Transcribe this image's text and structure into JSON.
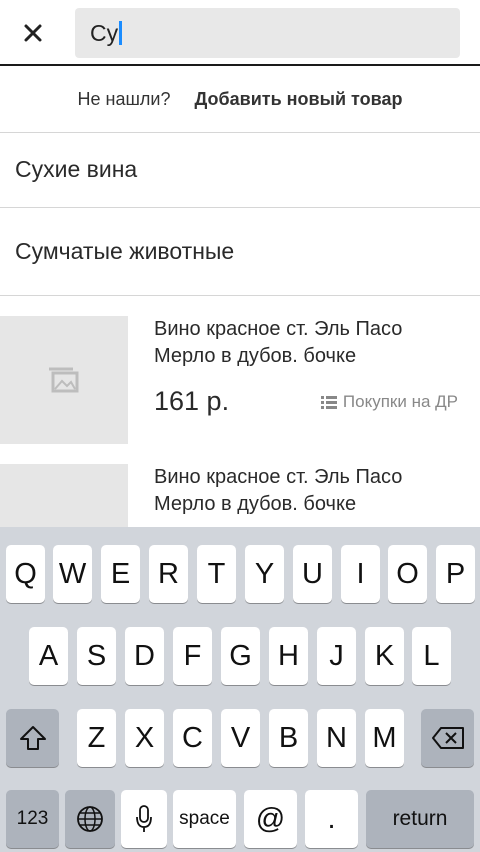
{
  "search": {
    "query": "Су"
  },
  "not_found": {
    "question": "Не нашли?",
    "add_label": "Добавить новый товар"
  },
  "categories": [
    "Сухие вина",
    "Сумчатые животные"
  ],
  "products": [
    {
      "title_line1": "Вино красное ст. Эль Пасо",
      "title_line2": "Мерло в дубов. бочке",
      "price": "161 р.",
      "list": "Покупки на ДР"
    },
    {
      "title_line1": "Вино красное ст. Эль Пасо",
      "title_line2": "Мерло в дубов. бочке"
    }
  ],
  "keyboard": {
    "row1": [
      "Q",
      "W",
      "E",
      "R",
      "T",
      "Y",
      "U",
      "I",
      "O",
      "P"
    ],
    "row2": [
      "A",
      "S",
      "D",
      "F",
      "G",
      "H",
      "J",
      "K",
      "L"
    ],
    "row3": [
      "Z",
      "X",
      "C",
      "V",
      "B",
      "N",
      "M"
    ],
    "numbers": "123",
    "space": "space",
    "at": "@",
    "dot": ".",
    "return": "return"
  },
  "colors": {
    "caret": "#1a8cff",
    "keyboard_bg": "#d1d5db"
  }
}
